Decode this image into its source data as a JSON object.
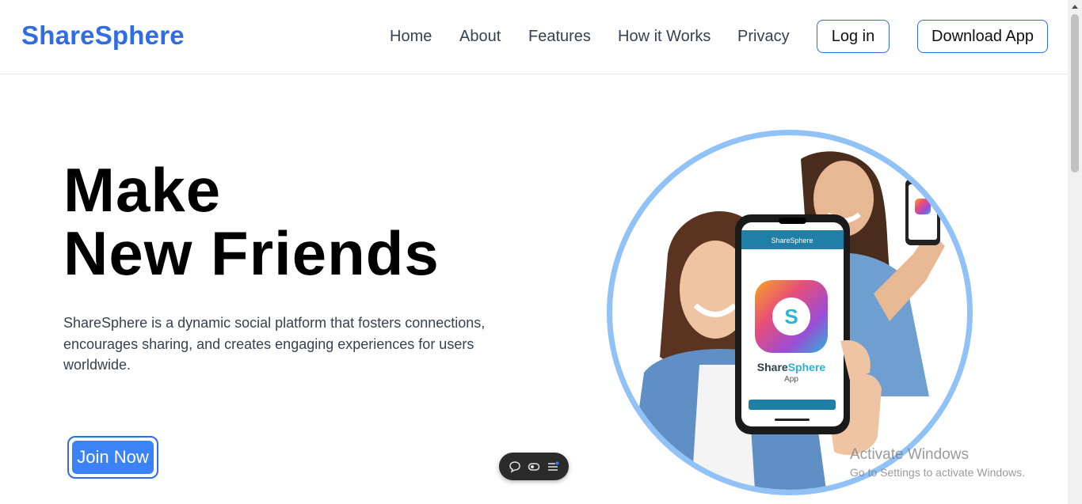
{
  "header": {
    "logo": "ShareSphere",
    "nav": [
      "Home",
      "About",
      "Features",
      "How it Works",
      "Privacy"
    ],
    "login_label": "Log in",
    "download_label": "Download App"
  },
  "hero": {
    "title_line1": "Make",
    "title_line2": "New Friends",
    "description": "ShareSphere is a dynamic social platform that fosters connections, encourages sharing, and creates engaging experiences for users worldwide.",
    "join_label": "Join Now"
  },
  "phone_mockup": {
    "app_header": "ShareSphere",
    "brand_part1": "Share",
    "brand_part2": "Sphere",
    "subtitle": "App",
    "logo_letter": "S"
  },
  "watermark": {
    "title": "Activate Windows",
    "subtitle": "Go to Settings to activate Windows."
  },
  "colors": {
    "brand": "#2f6ce5",
    "button": "#3b82f6",
    "circle_border": "#90c2f7",
    "app_header": "#1f7fa6"
  },
  "toolbar_icons": [
    "chat-bubble-icon",
    "toggle-icon",
    "menu-list-icon"
  ]
}
